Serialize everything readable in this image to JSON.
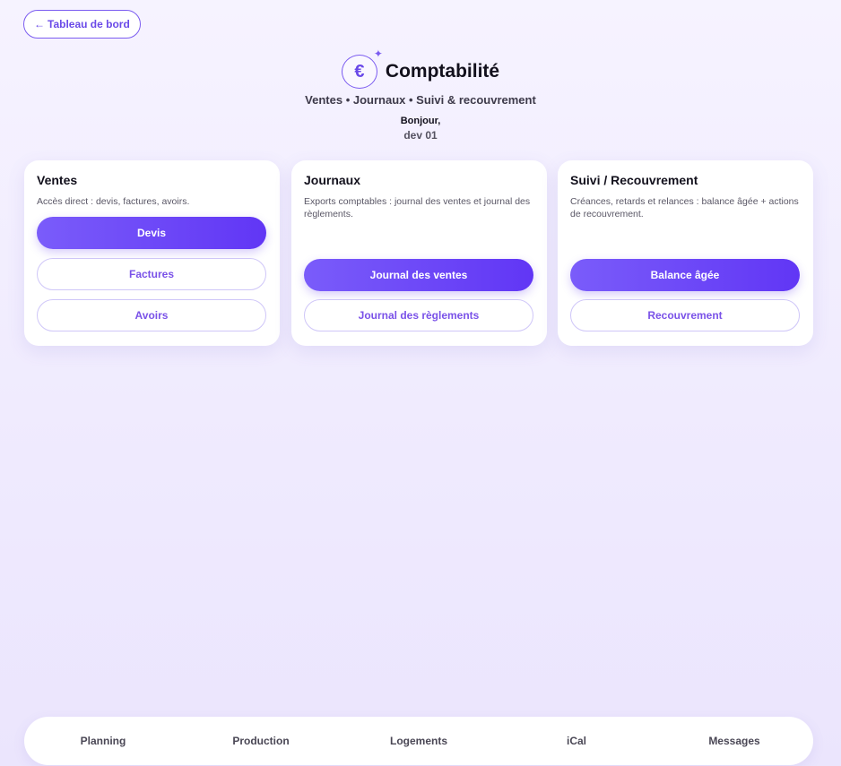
{
  "back": {
    "arrow": "←",
    "label": "Tableau de bord"
  },
  "header": {
    "logo_glyph": "€",
    "sparkle_glyph": "✦",
    "title": "Comptabilité",
    "subtitle": "Ventes • Journaux • Suivi & recouvrement",
    "greeting": "Bonjour,",
    "username": "dev 01"
  },
  "cards": [
    {
      "title": "Ventes",
      "desc": "Accès direct : devis, factures, avoirs.",
      "buttons": [
        "Devis",
        "Factures",
        "Avoirs"
      ]
    },
    {
      "title": "Journaux",
      "desc": "Exports comptables : journal des ventes et journal des règlements.",
      "buttons": [
        "Journal des ventes",
        "Journal des règlements"
      ]
    },
    {
      "title": "Suivi / Recouvrement",
      "desc": "Créances, retards et relances : balance âgée + actions de recouvrement.",
      "buttons": [
        "Balance âgée",
        "Recouvrement"
      ]
    }
  ],
  "nav": [
    "Planning",
    "Production",
    "Logements",
    "iCal",
    "Messages"
  ],
  "colors": {
    "accent": "#6a4ae8",
    "primary_gradient_start": "#7a5cfa",
    "primary_gradient_end": "#6136f5",
    "background": "#f2eefe"
  },
  "icons": {
    "logo": "euro-icon",
    "sparkle": "sparkle-icon",
    "back": "arrow-left-icon"
  }
}
